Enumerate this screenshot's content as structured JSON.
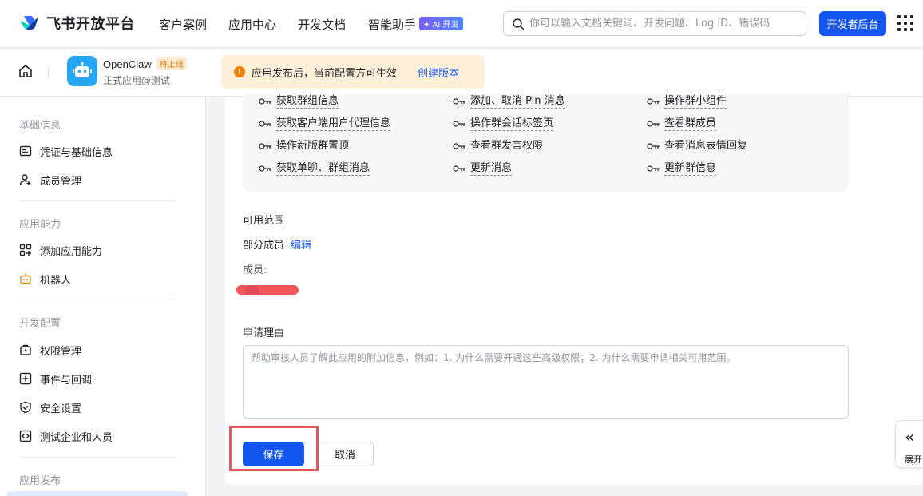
{
  "topnav": {
    "brand": "飞书开放平台",
    "links": [
      "客户案例",
      "应用中心",
      "开发文档",
      "智能助手"
    ],
    "ai_badge": "✦ AI 开发",
    "search_placeholder": "你可以输入文档关键词、开发问题、Log ID、错误码",
    "dev_button": "开发者后台"
  },
  "app": {
    "name": "OpenClaw",
    "status": "待上线",
    "subtitle": "正式应用@测试",
    "notice": "应用发布后，当前配置方可生效",
    "notice_link": "创建版本"
  },
  "sidebar": {
    "sections": [
      {
        "title": "基础信息",
        "items": [
          "凭证与基础信息",
          "成员管理"
        ]
      },
      {
        "title": "应用能力",
        "items": [
          "添加应用能力",
          "机器人"
        ]
      },
      {
        "title": "开发配置",
        "items": [
          "权限管理",
          "事件与回调",
          "安全设置",
          "测试企业和人员"
        ]
      },
      {
        "title": "应用发布",
        "items": []
      }
    ]
  },
  "permissions": [
    [
      "获取群组信息",
      "添加、取消 Pin 消息",
      "操作群小组件"
    ],
    [
      "获取客户端用户代理信息",
      "操作群会话标签页",
      "查看群成员"
    ],
    [
      "操作新版群置顶",
      "查看群发言权限",
      "查看消息表情回复"
    ],
    [
      "获取单聊、群组消息",
      "更新消息",
      "更新群信息"
    ]
  ],
  "scope": {
    "title": "可用范围",
    "value": "部分成员",
    "edit": "编辑",
    "members_label": "成员:"
  },
  "reason": {
    "title": "申请理由",
    "placeholder": "帮助审核人员了解此应用的附加信息，例如：1. 为什么需要开通这些高级权限；2. 为什么需要申请相关可用范围。"
  },
  "actions": {
    "save": "保存",
    "cancel": "取消"
  },
  "expand": {
    "arrow": "«",
    "label": "展开"
  },
  "colors": {
    "primary": "#1456f0",
    "warning": "#f77f00",
    "highlight": "#e4575a"
  }
}
